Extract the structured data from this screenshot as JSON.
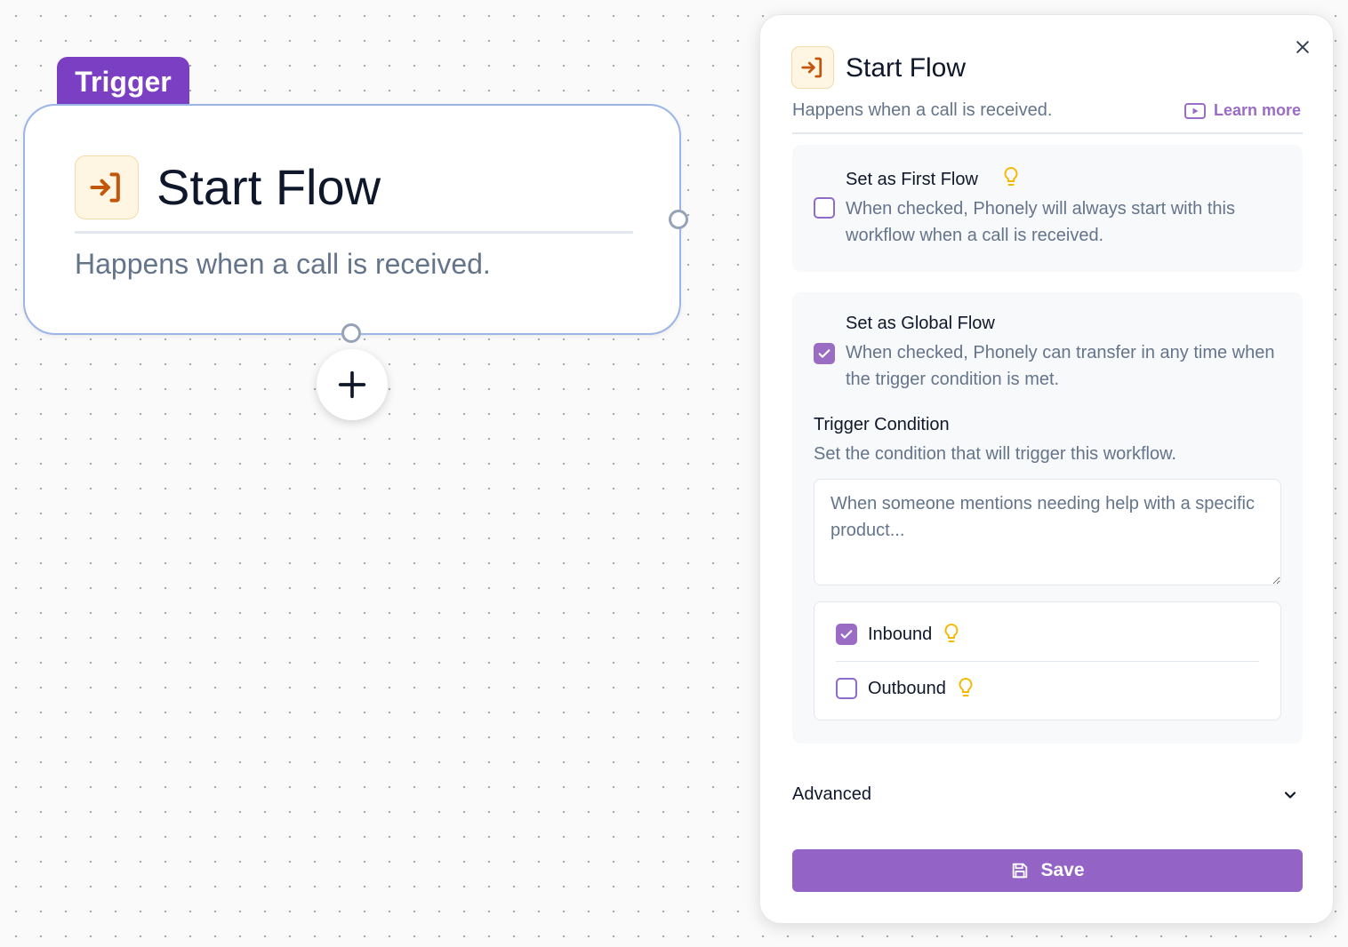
{
  "canvas": {
    "trigger_tag": "Trigger",
    "node": {
      "title": "Start Flow",
      "description": "Happens when a call is received.",
      "icon": "enter-icon"
    },
    "add_button_icon": "plus-icon"
  },
  "panel": {
    "title": "Start Flow",
    "subtitle": "Happens when a call is received.",
    "learn_more": "Learn more",
    "first_flow": {
      "label": "Set as First Flow",
      "description": "When checked, Phonely will always start with this workflow when a call is received.",
      "checked": false
    },
    "global_flow": {
      "label": "Set as Global Flow",
      "description": "When checked, Phonely can transfer in any time when the trigger condition is met.",
      "checked": true
    },
    "trigger_condition": {
      "label": "Trigger Condition",
      "description": "Set the condition that will trigger this workflow.",
      "placeholder": "When someone mentions needing help with a specific product...",
      "value": ""
    },
    "directions": [
      {
        "label": "Inbound",
        "checked": true
      },
      {
        "label": "Outbound",
        "checked": false
      }
    ],
    "advanced_label": "Advanced",
    "save_label": "Save"
  },
  "colors": {
    "accent": "#9363c6",
    "trigger_tag": "#7b3fc4",
    "icon_orange": "#c2570c",
    "tip_yellow": "#f5b800"
  }
}
